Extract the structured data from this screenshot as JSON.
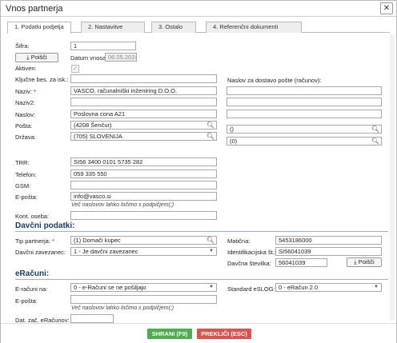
{
  "window": {
    "title": "Vnos partnerja",
    "close_glyph": "✕"
  },
  "tabs": [
    {
      "label": "1. Podatki podjetja"
    },
    {
      "label": "2. Nastavitve"
    },
    {
      "label": "3. Ostalo"
    },
    {
      "label": "4. Referenčni dokumenti"
    }
  ],
  "general": {
    "sifra_label": "Šifra:",
    "sifra_value": "1",
    "poisci_label": "Poišči",
    "datum_label": "Datum vnosa:",
    "datum_value": "06.05.2024",
    "aktiven_label": "Aktiven:",
    "aktiven_glyph": "✓",
    "kljucne_label": "Ključne bes. za isk.:",
    "kljucne_value": "",
    "naziv_label": "Naziv:",
    "naziv_required": "*",
    "naziv_value": "VASCO, računalniški inženiring D.O.O.",
    "naziv2_label": "Naziv2:",
    "naziv2_value": "",
    "naslov_label": "Naslov:",
    "naslov_value": "Poslovna cona A21",
    "posta_label": "Pošta:",
    "posta_value": "(4208 Šenčur)",
    "drzava_label": "Država:",
    "drzava_value": "(705) SLOVENIJA",
    "dostava_label": "Naslov za dostavo pošte (računov):",
    "dostava_line1": "",
    "dostava_line2": "",
    "dostava_line3": "",
    "dostava_posta": "()",
    "dostava_drzava": "(0)"
  },
  "contact": {
    "trr_label": "TRR:",
    "trr_value": "SI56 3400 0101 5735 282",
    "telefon_label": "Telefon:",
    "telefon_value": "059 335 550",
    "gsm_label": "GSM:",
    "gsm_value": "",
    "eposta_label": "E-pošta:",
    "eposta_value": "info@vasco.si",
    "eposta_hint": "Več naslovov lahko ločimo s podpičjem(;)",
    "kont_label": "Kont. oseba:",
    "kont_value": ""
  },
  "tax": {
    "section_title": "Davčni podatki:",
    "tip_label": "Tip partnerja:",
    "tip_required": "*",
    "tip_value": "(1) Domači kupec",
    "zavezanec_label": "Davčni zavezanec:",
    "zavezanec_value": "1 - Je davčni zavezanec",
    "maticna_label": "Matična:",
    "maticna_value": "5453186000",
    "id_label": "Identifikacijska št.:",
    "id_value": "SI56041039",
    "davcna_label": "Davčna številka:",
    "davcna_value": "56041039",
    "poisci_label": "Poišči"
  },
  "eracuni": {
    "section_title": "eRačuni:",
    "na_label": "E-računi na:",
    "na_value": "0 - e-Računi se ne pošiljajo",
    "standard_label": "Standard eSLOG:",
    "standard_value": "0 - eRačun 2.0",
    "eposta_label": "E-pošta:",
    "eposta_value": "",
    "eposta_hint": "Več naslovov lahko ločimo s podpičjem(;)",
    "dat_label": "Dat. zač. eRačunov:",
    "dat_value": ""
  },
  "footer": {
    "save_label": "SHRANI (F9)",
    "cancel_label": "PREKLIČI (ESC)",
    "save_color": "#4cae4c",
    "cancel_color": "#d9534f"
  },
  "icons": {
    "search": "search-icon",
    "download": "download-icon",
    "dropdown": "chevron-down-icon"
  }
}
